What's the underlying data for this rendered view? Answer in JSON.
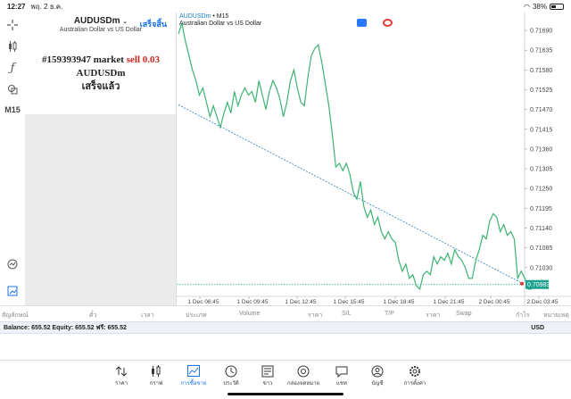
{
  "status": {
    "time": "12:27",
    "date": "พฤ. 2 ธ.ค.",
    "battery": "38%"
  },
  "left_toolbar": {
    "timeframe": "M15"
  },
  "order": {
    "symbol": "AUDUSDm",
    "symbol_desc": "Australian Dollar vs US Dollar",
    "done": "เสร็จสิ้น",
    "line1_id": "#159393947 market",
    "line1_side": "sell 0.03",
    "line2": "AUDUSDm",
    "line3": "เสร็จแล้ว"
  },
  "chart": {
    "symbol": "AUDUSDm",
    "separator": "•",
    "timeframe": "M15",
    "desc": "Australian Dollar vs US Dollar",
    "current_price_label": "0.70983",
    "colors": {
      "line": "#3cb371",
      "trend": "#2a7fb8",
      "price": "#1aa28e",
      "grid": "#e6e6e6",
      "btn_blue": "#2979ff",
      "btn_red": "#e53935"
    }
  },
  "chart_data": {
    "type": "line",
    "title": "",
    "ylim": [
      0.7095,
      0.7172
    ],
    "y_ticks": [
      "0.71690",
      "0.71635",
      "0.71580",
      "0.71525",
      "0.71470",
      "0.71415",
      "0.71360",
      "0.71305",
      "0.71250",
      "0.71195",
      "0.71140",
      "0.71085",
      "0.71030",
      "0.70983"
    ],
    "x_ticks": [
      "1 Dec 06:45",
      "1 Dec 09:45",
      "1 Dec 12:45",
      "1 Dec 15:45",
      "1 Dec 18:45",
      "1 Dec 21:45",
      "2 Dec 00:45",
      "2 Dec 03:45"
    ],
    "series": [
      {
        "values": [
          0.7168,
          0.7171,
          0.7166,
          0.7162,
          0.7158,
          0.7155,
          0.7151,
          0.7153,
          0.7149,
          0.7145,
          0.7148,
          0.7145,
          0.7142,
          0.7146,
          0.7149,
          0.7146,
          0.7152,
          0.7148,
          0.7151,
          0.7153,
          0.7151,
          0.7152,
          0.7149,
          0.7155,
          0.7151,
          0.7147,
          0.7152,
          0.7155,
          0.7153,
          0.715,
          0.7145,
          0.7149,
          0.7155,
          0.7158,
          0.7153,
          0.7149,
          0.7148,
          0.7156,
          0.7162,
          0.7164,
          0.7165,
          0.716,
          0.7154,
          0.7148,
          0.714,
          0.7131,
          0.7132,
          0.713,
          0.7132,
          0.7129,
          0.7124,
          0.7122,
          0.7127,
          0.712,
          0.7117,
          0.7119,
          0.7115,
          0.7117,
          0.7113,
          0.7111,
          0.7113,
          0.7111,
          0.711,
          0.7105,
          0.7102,
          0.7104,
          0.71,
          0.7101,
          0.7098,
          0.7097,
          0.7101,
          0.7102,
          0.7101,
          0.7106,
          0.7104,
          0.7106,
          0.7105,
          0.7107,
          0.7104,
          0.7108,
          0.7106,
          0.7105,
          0.7103,
          0.71,
          0.71,
          0.7105,
          0.7108,
          0.7112,
          0.7111,
          0.7116,
          0.7118,
          0.7117,
          0.7113,
          0.7115,
          0.7112,
          0.7113,
          0.7111,
          0.71,
          0.7102,
          0.71,
          0.7097,
          0.7097
        ]
      },
      {
        "name": "trend",
        "values": [
          0.71483,
          0.70983
        ]
      },
      {
        "name": "price",
        "values": [
          0.70983
        ]
      }
    ]
  },
  "terminal": {
    "headers": [
      "สัญลักษณ์",
      "ตั๋ว",
      "เวลา",
      "ประเภท",
      "Volume",
      "ราคา",
      "S/L",
      "T/P",
      "ราคา",
      "Swap",
      "กำไร",
      "หมายเหตุ"
    ],
    "balance_text": "Balance: 655.52 Equity: 655.52 ฟรี: 655.52",
    "currency": "USD"
  },
  "nav": [
    {
      "label": "ราคา",
      "icon": "arrows-up-down-icon"
    },
    {
      "label": "กราฟ",
      "icon": "candlestick-icon"
    },
    {
      "label": "การซื้อขาย",
      "icon": "trade-chart-icon"
    },
    {
      "label": "ประวัติ",
      "icon": "history-icon"
    },
    {
      "label": "ข่าว",
      "icon": "news-icon"
    },
    {
      "label": "กล่องจดหมาย",
      "icon": "mailbox-icon"
    },
    {
      "label": "แชท",
      "icon": "chat-icon"
    },
    {
      "label": "บัญชี",
      "icon": "account-icon"
    },
    {
      "label": "การตั้งค่า",
      "icon": "settings-icon"
    }
  ]
}
